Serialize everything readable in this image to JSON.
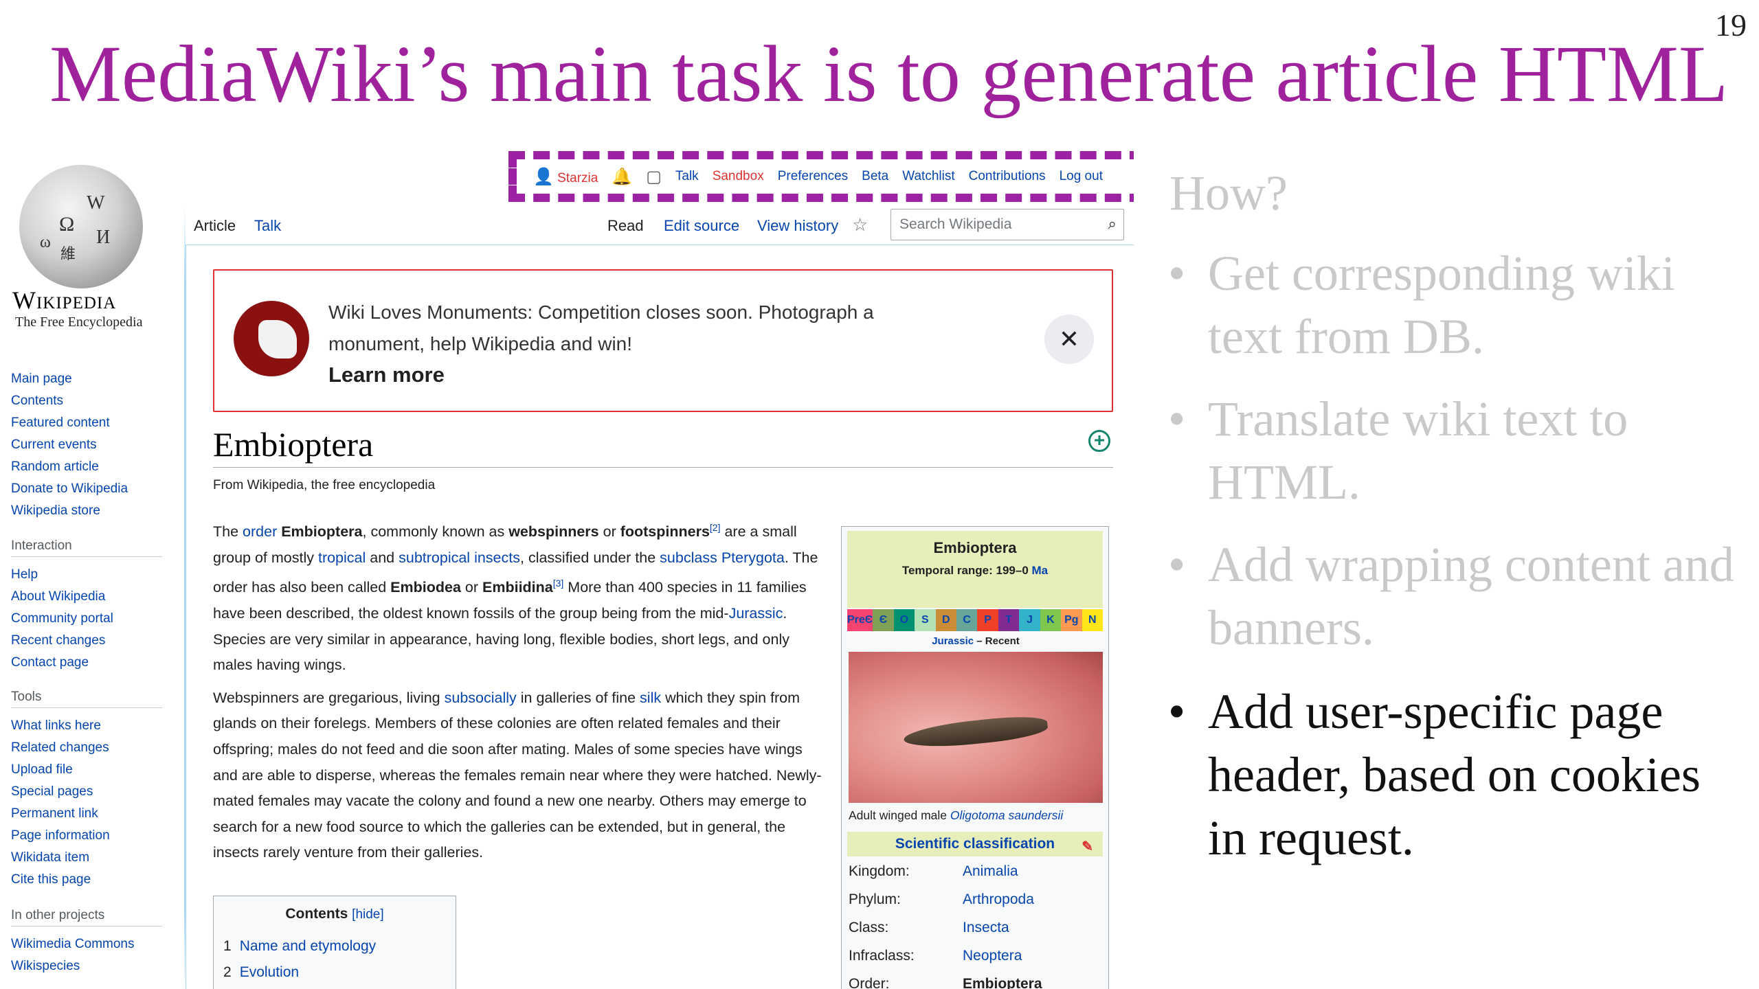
{
  "slide": {
    "title": "MediaWiki’s main task is to generate article HTML",
    "number": "19",
    "how": "How?",
    "bullets": [
      "Get corresponding wiki text from DB.",
      "Translate wiki text to HTML.",
      "Add wrapping content and banners.",
      "Add user-specific page header, based on cookies in request."
    ],
    "bullet_dot": "•",
    "colors": {
      "title": "#a0219c",
      "dim": "#c9c9c9",
      "highlight_box": "#9b23a3"
    }
  },
  "wiki": {
    "logo": {
      "wordmark": "Wikipedia",
      "tagline": "The Free Encyclopedia",
      "glyphs": [
        "Ω",
        "W",
        "И",
        "維",
        "ω"
      ]
    },
    "personal": {
      "user": "Starzia",
      "links": [
        "Talk",
        "Sandbox",
        "Preferences",
        "Beta",
        "Watchlist",
        "Contributions",
        "Log out"
      ]
    },
    "tabs": {
      "article": "Article",
      "talk": "Talk",
      "read": "Read",
      "edit": "Edit source",
      "history": "View history",
      "search_placeholder": "Search Wikipedia"
    },
    "sidebar": {
      "nav": [
        "Main page",
        "Contents",
        "Featured content",
        "Current events",
        "Random article",
        "Donate to Wikipedia",
        "Wikipedia store"
      ],
      "interaction": {
        "heading": "Interaction",
        "items": [
          "Help",
          "About Wikipedia",
          "Community portal",
          "Recent changes",
          "Contact page"
        ]
      },
      "tools": {
        "heading": "Tools",
        "items": [
          "What links here",
          "Related changes",
          "Upload file",
          "Special pages",
          "Permanent link",
          "Page information",
          "Wikidata item",
          "Cite this page"
        ]
      },
      "other": {
        "heading": "In other projects",
        "items": [
          "Wikimedia Commons",
          "Wikispecies"
        ]
      }
    },
    "banner": {
      "text": "Wiki Loves Monuments: Competition closes soon. Photograph a monument, help Wikipedia and win!",
      "learn_more": "Learn more",
      "close": "✕"
    },
    "article": {
      "title": "Embioptera",
      "from": "From Wikipedia, the free encyclopedia",
      "p1": {
        "t1": "The ",
        "l1": "order",
        "t2": " ",
        "b1": "Embioptera",
        "t3": ", commonly known as ",
        "b2": "webspinners",
        "t4": " or ",
        "b3": "footspinners",
        "s1": "[2]",
        "t5": " are a small group of mostly ",
        "l2": "tropical",
        "t6": " and ",
        "l3": "subtropical",
        "t7": " ",
        "l4": "insects",
        "t8": ", classified under the ",
        "l5": "subclass",
        "t9": " ",
        "l6": "Pterygota",
        "t10": ". The order has also been called ",
        "b4": "Embiodea",
        "t11": " or ",
        "b5": "Embiidina",
        "s2": "[3]",
        "t12": " More than 400 species in 11 families have been described, the oldest known fossils of the group being from the mid-",
        "l7": "Jurassic",
        "t13": ". Species are very similar in appearance, having long, flexible bodies, short legs, and only males having wings."
      },
      "p2": {
        "t1": "Webspinners are gregarious, living ",
        "l1": "subsocially",
        "t2": " in galleries of fine ",
        "l2": "silk",
        "t3": " which they spin from glands on their forelegs. Members of these colonies are often related females and their offspring; males do not feed and die soon after mating. Males of some species have wings and are able to disperse, whereas the females remain near where they were hatched. Newly-mated females may vacate the colony and found a new one nearby. Others may emerge to search for a new food source to which the galleries can be extended, but in general, the insects rarely venture from their galleries."
      },
      "toc": {
        "title": "Contents",
        "hide": "[hide]",
        "items": [
          {
            "num": "1",
            "label": "Name and etymology"
          },
          {
            "num": "2",
            "label": "Evolution"
          }
        ]
      }
    },
    "infobox": {
      "name": "Embioptera",
      "range_label": "Temporal range: 199–0 ",
      "range_unit": "Ma",
      "timescale": [
        "PreЄ",
        "Є",
        "O",
        "S",
        "D",
        "C",
        "P",
        "T",
        "J",
        "K",
        "Pg",
        "N"
      ],
      "timescale_colors": [
        "#f74370",
        "#7fa056",
        "#009270",
        "#b3e1b6",
        "#cb8c37",
        "#67a599",
        "#f04028",
        "#812b92",
        "#34b2c9",
        "#7fc64e",
        "#fd9a52",
        "#ffe619"
      ],
      "period_main": "Jurassic",
      "period_rest": " – Recent",
      "caption_prefix": "Adult winged male ",
      "caption_species": "Oligotoma saundersii",
      "sci_heading": "Scientific classification",
      "rows": [
        {
          "k": "Kingdom:",
          "v": "Animalia"
        },
        {
          "k": "Phylum:",
          "v": "Arthropoda"
        },
        {
          "k": "Class:",
          "v": "Insecta"
        },
        {
          "k": "Infraclass:",
          "v": "Neoptera"
        },
        {
          "k": "Order:",
          "v": "Embioptera"
        }
      ]
    }
  }
}
